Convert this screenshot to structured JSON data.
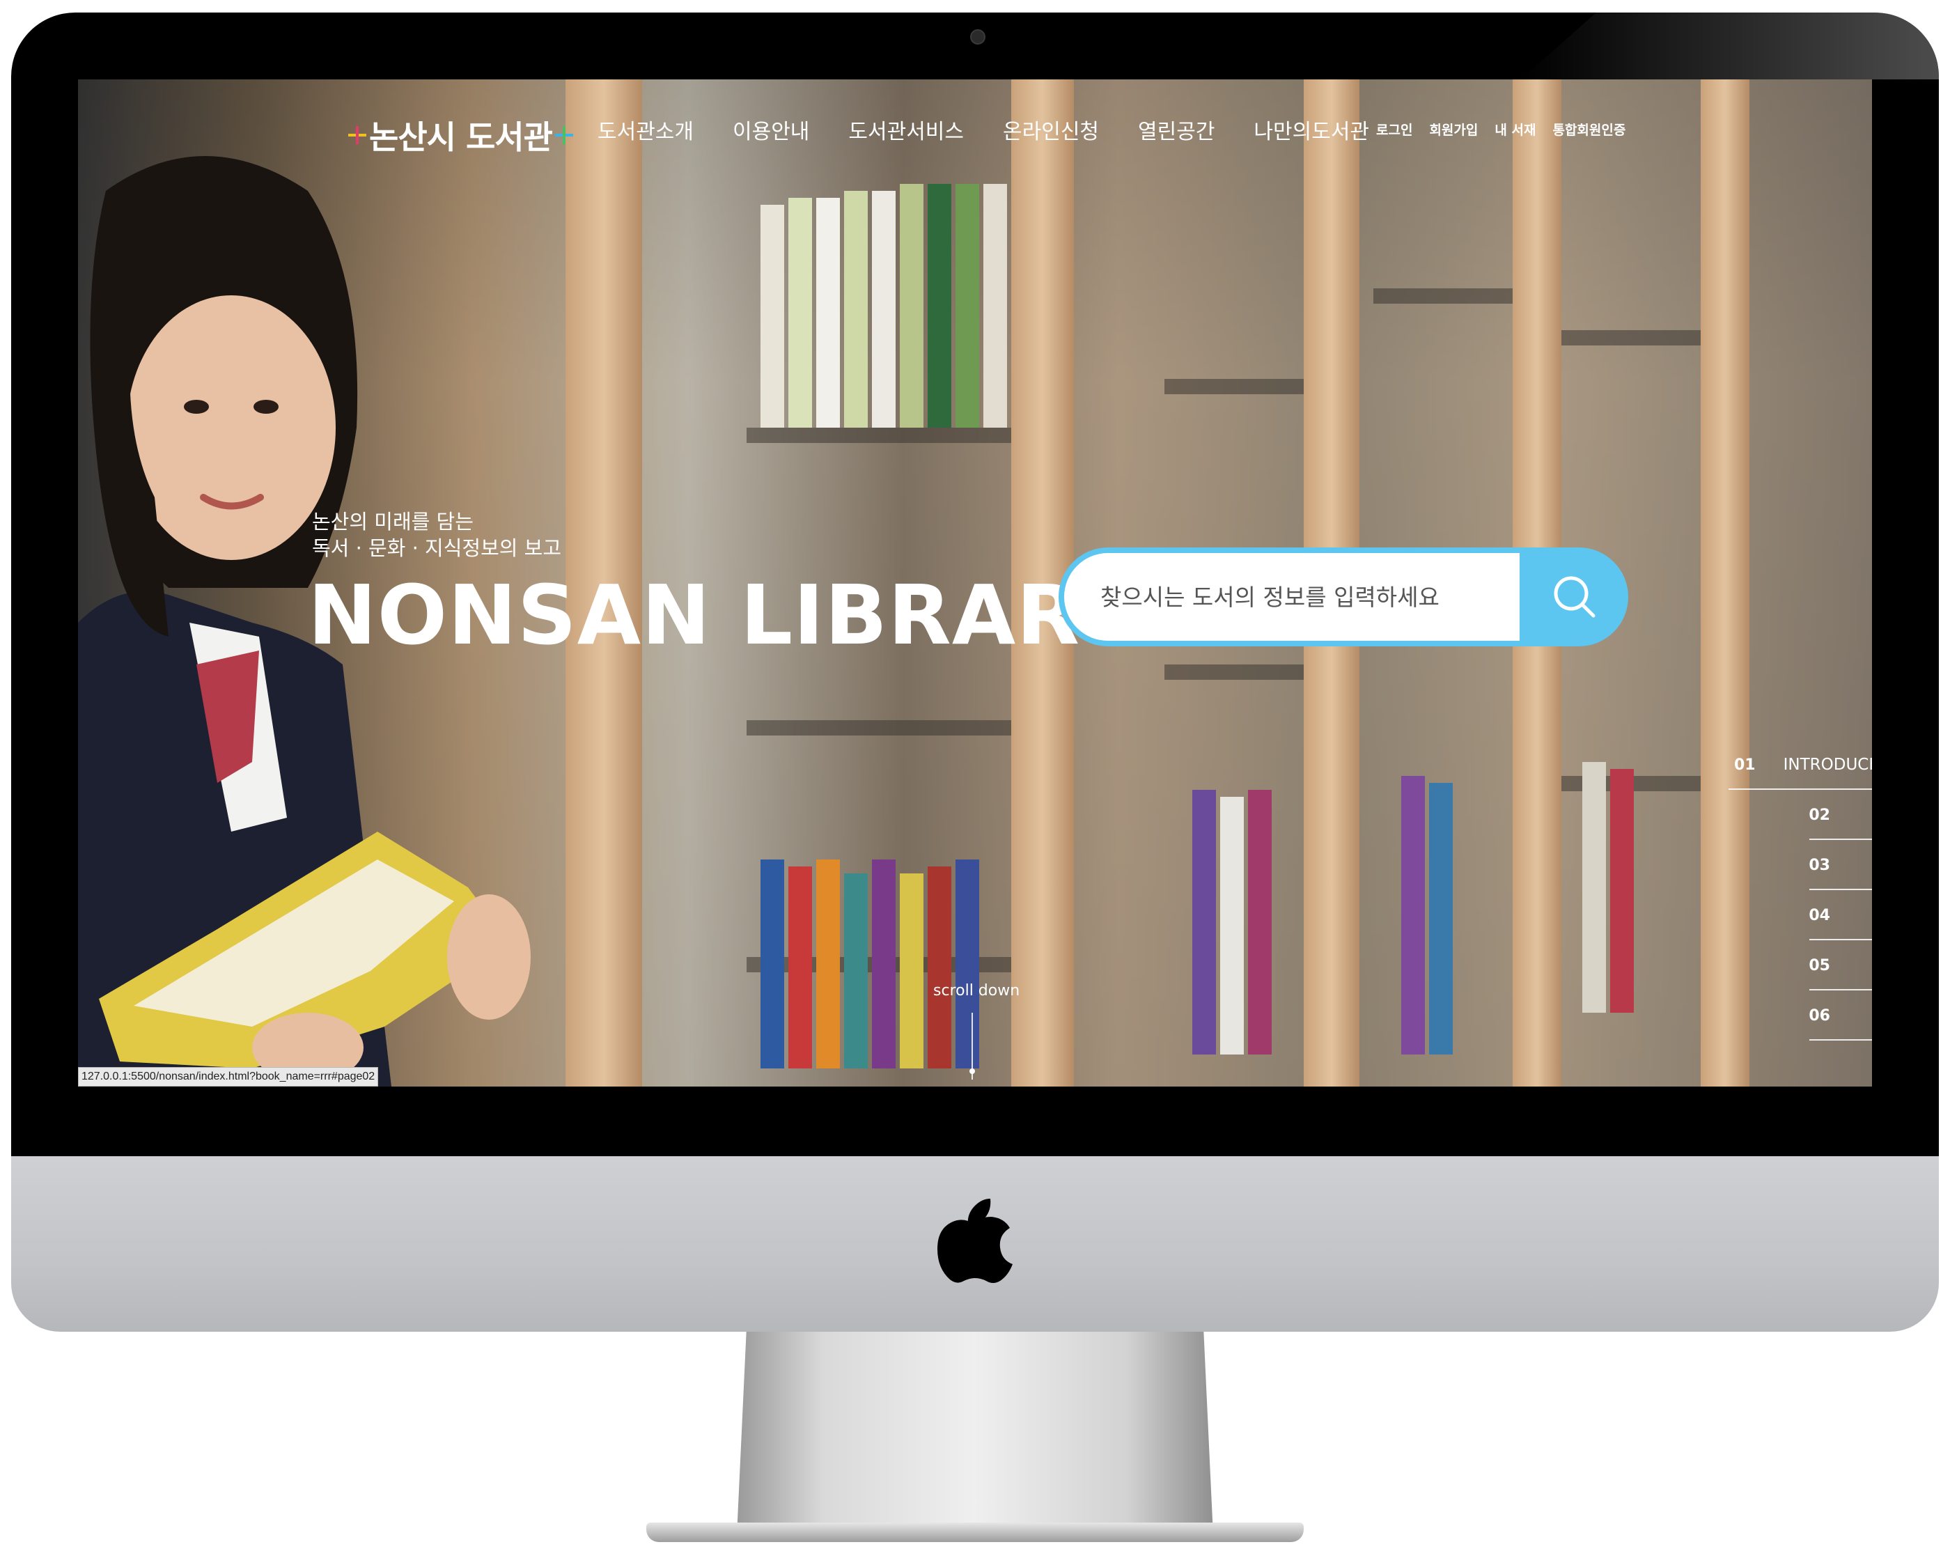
{
  "header": {
    "logo_text": "논산시 도서관",
    "menu": [
      "도서관소개",
      "이용안내",
      "도서관서비스",
      "온라인신청",
      "열린공간",
      "나만의도서관"
    ],
    "util": [
      "로그인",
      "회원가입",
      "내 서재",
      "통합회원인증"
    ]
  },
  "hero": {
    "tagline_line1": "논산의 미래를 담는",
    "tagline_line2": "독서 · 문화 · 지식정보의 보고",
    "title": "NONSAN LIBRARY"
  },
  "search": {
    "placeholder": "찾으시는 도서의 정보를 입력하세요",
    "button_icon": "search-icon",
    "accent_color": "#5cc6f0"
  },
  "pager": {
    "items": [
      {
        "num": "01",
        "label": "INTRODUCE"
      },
      {
        "num": "02",
        "label": ""
      },
      {
        "num": "03",
        "label": ""
      },
      {
        "num": "04",
        "label": ""
      },
      {
        "num": "05",
        "label": ""
      },
      {
        "num": "06",
        "label": ""
      }
    ],
    "active_index": 0
  },
  "scroll": {
    "label": "scroll down"
  },
  "status_bar": {
    "url": "127.0.0.1:5500/nonsan/index.html?book_name=rrr#page02"
  },
  "device": {
    "logo_icon": "apple-logo-icon"
  }
}
